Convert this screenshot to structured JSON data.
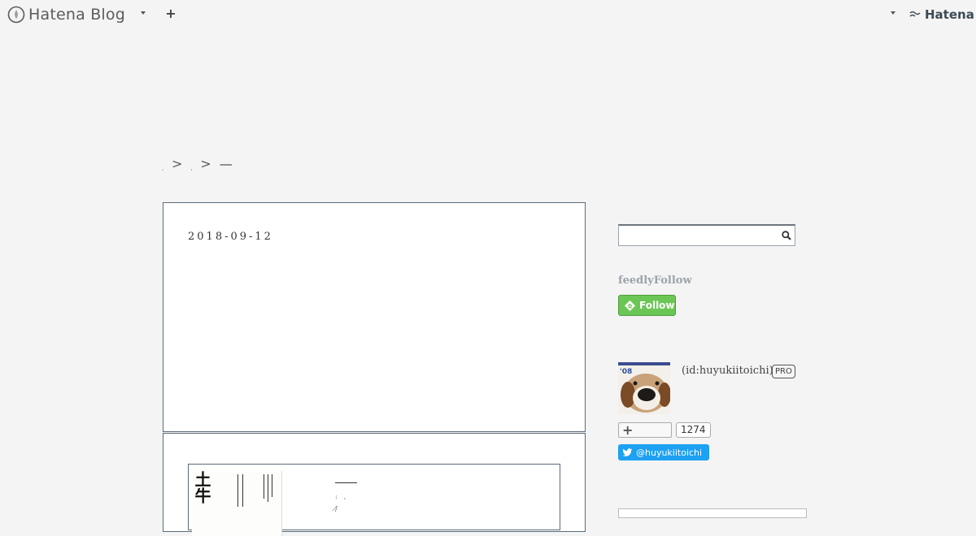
{
  "topbar": {
    "logo_text": "Hatena Blog",
    "hatena_label": "Hatena"
  },
  "breadcrumb": {
    "items": [
      "ˌ",
      "ˌ"
    ],
    "separator": ">",
    "current": "—"
  },
  "entries": [
    {
      "date": "2018-09-12"
    },
    {
      "book": {
        "cover_kanji": "土牛",
        "title_rule": "——",
        "meta1": ":　,",
        "meta2": "/̸"
      }
    }
  ],
  "sidebar": {
    "search": {
      "placeholder": "",
      "value": ""
    },
    "feedly": {
      "title": "feedlyFollow",
      "button_label": "Follow"
    },
    "profile": {
      "id_text": "(id:huyukiitoichi)",
      "badge": "PRO",
      "follow_plus": "+",
      "follow_count": "1274",
      "twitter_label": "@huyukiitoichi"
    }
  },
  "colors": {
    "background": "#f4f4f4",
    "feedly_green": "#6cc655",
    "twitter_blue": "#1da1f2",
    "box_border": "#5c6b78"
  }
}
